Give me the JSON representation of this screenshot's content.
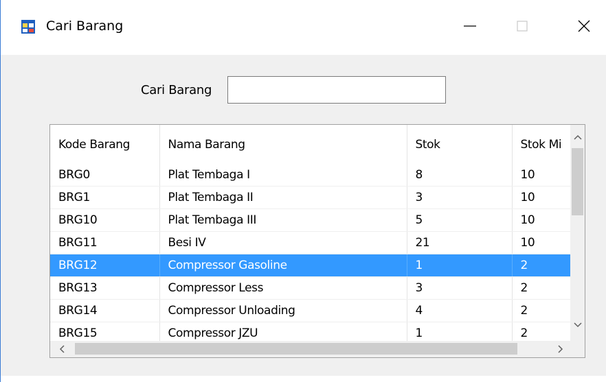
{
  "window": {
    "title": "Cari Barang",
    "accent": "#3399ff",
    "icons": {
      "app": "app-window-icon",
      "minimize": "minimize-icon",
      "maximize": "maximize-icon",
      "close": "close-icon"
    }
  },
  "search": {
    "label": "Cari Barang",
    "value": "",
    "placeholder": ""
  },
  "grid": {
    "columns": [
      "Kode Barang",
      "Nama Barang",
      "Stok",
      "Stok Mi"
    ],
    "rows": [
      [
        "BRG0",
        "Plat Tembaga I",
        "8",
        "10"
      ],
      [
        "BRG1",
        "Plat Tembaga II",
        "3",
        "10"
      ],
      [
        "BRG10",
        "Plat Tembaga III",
        "5",
        "10"
      ],
      [
        "BRG11",
        "Besi IV",
        "21",
        "10"
      ],
      [
        "BRG12",
        "Compressor Gasoline",
        "1",
        "2"
      ],
      [
        "BRG13",
        "Compressor Less",
        "3",
        "2"
      ],
      [
        "BRG14",
        "Compressor Unloading",
        "4",
        "2"
      ],
      [
        "BRG15",
        "Compressor JZU",
        "1",
        "2"
      ]
    ],
    "selected_row_index": 4
  }
}
